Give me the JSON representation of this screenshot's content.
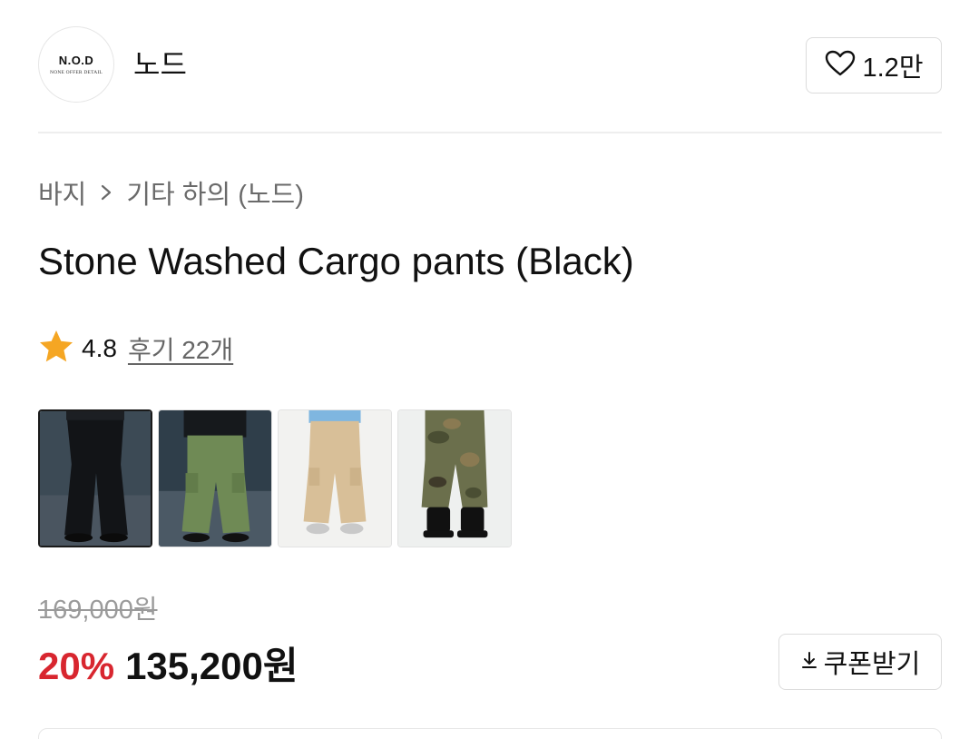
{
  "brand": {
    "logo_text": "N.O.D",
    "logo_subtext": "NONE OFFER DETAIL",
    "name": "노드",
    "like_icon": "heart-outline-icon",
    "like_count": "1.2만"
  },
  "breadcrumb": {
    "items": [
      "바지",
      "기타 하의 (노드)"
    ],
    "separator_icon": "chevron-right-icon"
  },
  "product": {
    "title": "Stone Washed Cargo pants (Black)",
    "rating": {
      "icon": "star-icon",
      "star_color": "#f5a623",
      "value": "4.8",
      "review_link": "후기 22개"
    },
    "thumbnails": [
      {
        "alt": "black cargo pants",
        "selected": true
      },
      {
        "alt": "khaki cargo pants"
      },
      {
        "alt": "beige cargo pants"
      },
      {
        "alt": "camo cargo pants"
      }
    ],
    "original_price": "169,000원",
    "discount_rate": "20%",
    "discount_color": "#d8262f",
    "sale_price": "135,200원"
  },
  "coupon": {
    "icon": "download-icon",
    "label": "쿠폰받기"
  }
}
